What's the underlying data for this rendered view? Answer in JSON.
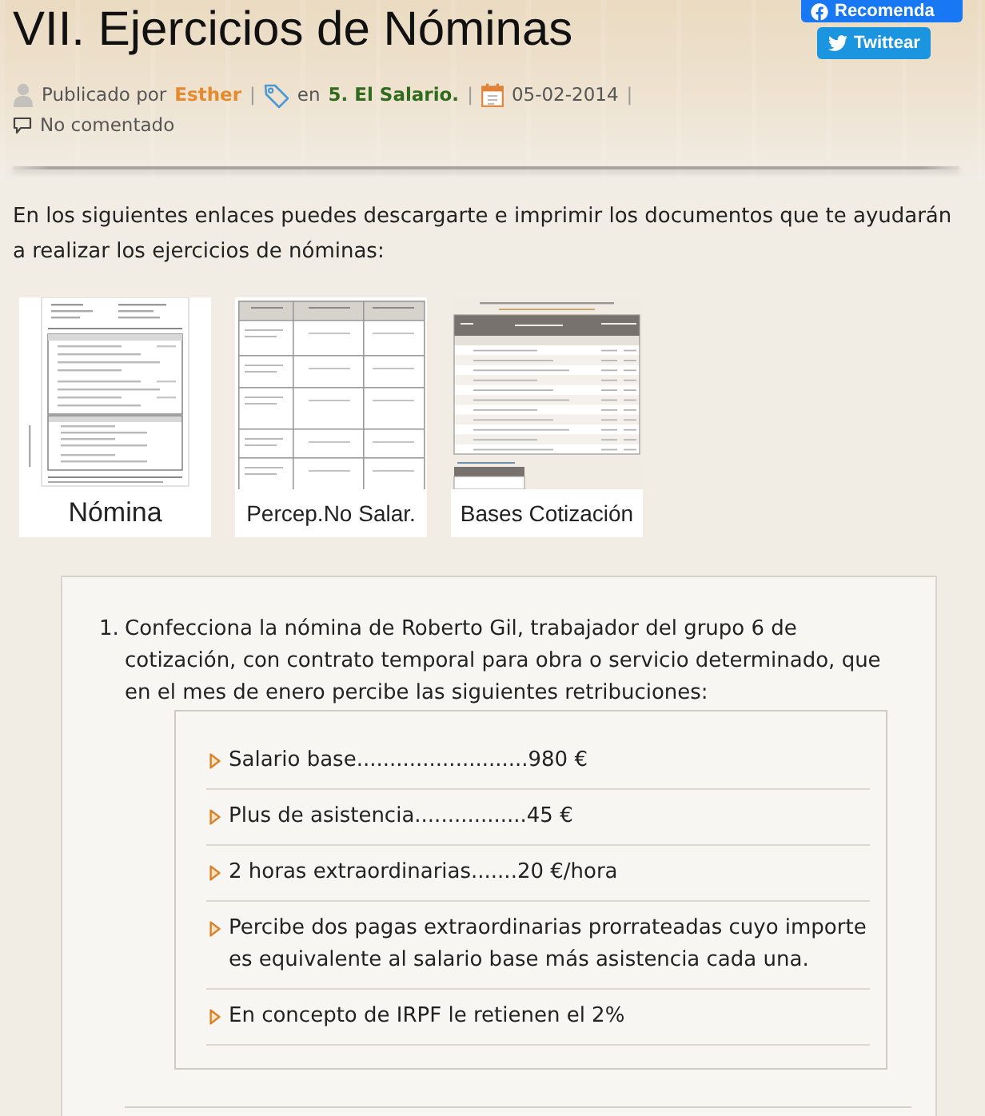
{
  "social_buttons": [
    {
      "kind": "facebook",
      "label": "Recomenda"
    },
    {
      "kind": "twitter",
      "label": "Twittear"
    }
  ],
  "title": "VII. Ejercicios de Nóminas",
  "meta": [
    {
      "kind": "author",
      "prefix": "Publicado por",
      "link": "Esther",
      "separator": "|"
    },
    {
      "kind": "category",
      "prefix": "en",
      "link": "5. El Salario.",
      "separator": "|"
    },
    {
      "kind": "date",
      "text": "05-02-2014",
      "separator": "|"
    },
    {
      "kind": "comments",
      "link": "No comentado"
    }
  ],
  "intro": "En los siguientes enlaces puedes descargarte e imprimir los documentos que te ayudarán a realizar los ejercicios de nóminas:",
  "downloads": [
    {
      "kind": "payslip",
      "label": "Nómina"
    },
    {
      "kind": "table",
      "label": "Percep.No Salar."
    },
    {
      "kind": "rates",
      "label": "Bases Cotización"
    }
  ],
  "exercises": [
    {
      "number": "1.",
      "statement": "Confecciona la nómina de Roberto Gil, trabajador del grupo 6 de cotización, con contrato temporal para obra o servicio determinado, que en el mes de enero percibe las siguientes retribuciones:",
      "details": [
        "Salario base..........................980 €",
        "Plus de asistencia.................45 €",
        "2 horas extraordinarias.......20 €/hora",
        "Percibe dos pagas extraordinarias prorrateadas cuyo importe es equivalente al salario base más asistencia cada una.",
        "En concepto de IRPF le retienen el 2%"
      ]
    }
  ]
}
